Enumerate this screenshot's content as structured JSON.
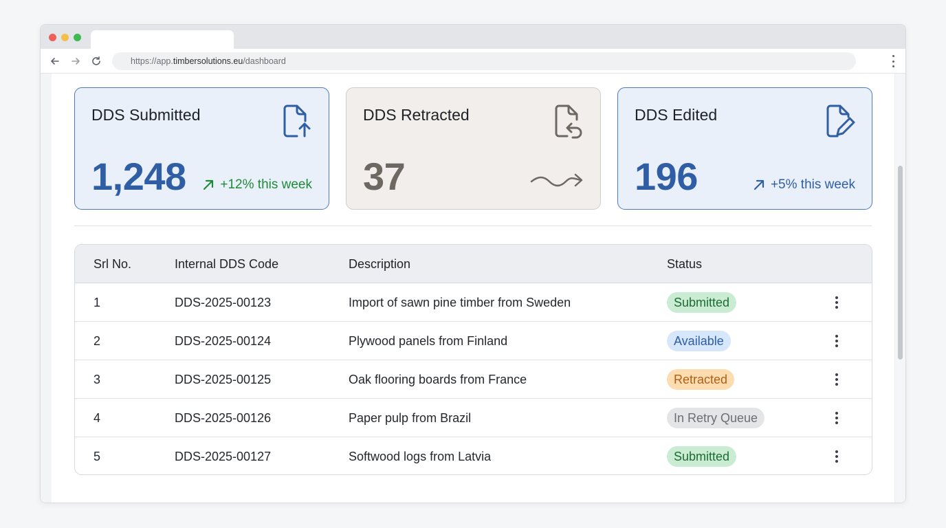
{
  "browser": {
    "url_prefix": "https://app.",
    "url_domain": "timbersolutions.eu",
    "url_path": "/dashboard"
  },
  "cards": [
    {
      "title": "DDS Submitted",
      "value": "1,248",
      "trend": "+12% this week",
      "icon": "file-upload-icon",
      "trend_icon": "trend-up-arrow-icon",
      "accent": "#2f5ea5",
      "trend_color": "#1f8a3a"
    },
    {
      "title": "DDS Retracted",
      "value": "37",
      "trend": "",
      "icon": "file-return-icon",
      "trend_icon": "wave-arrow-icon",
      "accent": "#6e6862"
    },
    {
      "title": "DDS Edited",
      "value": "196",
      "trend": "+5% this week",
      "icon": "file-edit-icon",
      "trend_icon": "trend-up-arrow-icon",
      "accent": "#2f5ea5",
      "trend_color": "#2f5ea5"
    }
  ],
  "table": {
    "headers": [
      "Srl No.",
      "Internal DDS Code",
      "Description",
      "Status"
    ],
    "rows": [
      {
        "srl": "1",
        "code": "DDS-2025-00123",
        "description": "Import of sawn pine timber from Sweden",
        "status": "Submitted"
      },
      {
        "srl": "2",
        "code": "DDS-2025-00124",
        "description": "Plywood panels from Finland",
        "status": "Available"
      },
      {
        "srl": "3",
        "code": "DDS-2025-00125",
        "description": "Oak flooring boards from France",
        "status": "Retracted"
      },
      {
        "srl": "4",
        "code": "DDS-2025-00126",
        "description": "Paper pulp from Brazil",
        "status": "In Retry Queue"
      },
      {
        "srl": "5",
        "code": "DDS-2025-00127",
        "description": "Softwood logs from Latvia",
        "status": "Submitted"
      }
    ]
  },
  "status_colors": {
    "Submitted": "#1d6b35",
    "Available": "#2f5ea5",
    "Retracted": "#b05f16",
    "In Retry Queue": "#6b6f75"
  }
}
